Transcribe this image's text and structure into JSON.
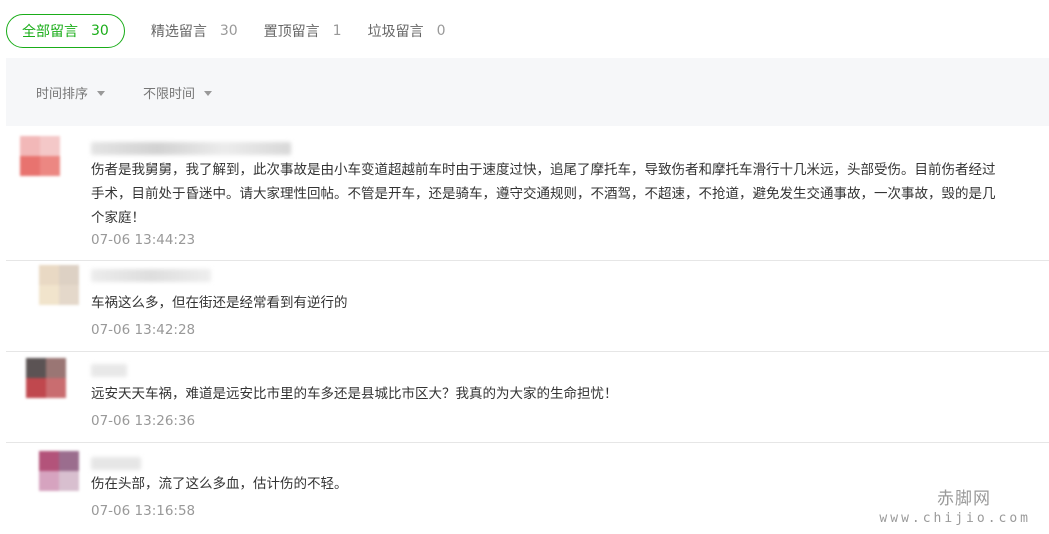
{
  "tabs": [
    {
      "label": "全部留言",
      "count": "30"
    },
    {
      "label": "精选留言",
      "count": "30"
    },
    {
      "label": "置顶留言",
      "count": "1"
    },
    {
      "label": "垃圾留言",
      "count": "0"
    }
  ],
  "filters": {
    "sort": "时间排序",
    "time_range": "不限时间"
  },
  "comments": [
    {
      "content": "伤者是我舅舅，我了解到，此次事故是由小车变道超越前车时由于速度过快，追尾了摩托车，导致伤者和摩托车滑行十几米远，头部受伤。目前伤者经过手术，目前处于昏迷中。请大家理性回帖。不管是开车，还是骑车，遵守交通规则，不酒驾，不超速，不抢道，避免发生交通事故，一次事故，毁的是几个家庭！",
      "time": "07-06 13:44:23",
      "avatar_colors": [
        "#f2b8b8",
        "#f4c8c8",
        "#e8736f",
        "#ec8782"
      ]
    },
    {
      "content": "车祸这么多，但在街还是经常看到有逆行的",
      "time": "07-06 13:42:28",
      "avatar_colors": [
        "#e9d9c4",
        "#ddd1c4",
        "#f1e4cc",
        "#e4d8ca"
      ]
    },
    {
      "content": "远安天天车祸，难道是远安比市里的车多还是县城比市区大？我真的为大家的生命担忧！",
      "time": "07-06 13:26:36",
      "avatar_colors": [
        "#5b5354",
        "#9a7674",
        "#c0484e",
        "#c96d70"
      ]
    },
    {
      "content": "伤在头部，流了这么多血，估计伤的不轻。",
      "time": "07-06 13:16:58",
      "avatar_colors": [
        "#b3537a",
        "#9b6d8e",
        "#d6a3bf",
        "#d8bfcf"
      ]
    }
  ],
  "watermark": {
    "name": "赤脚网",
    "url": "www.chijio.com"
  }
}
